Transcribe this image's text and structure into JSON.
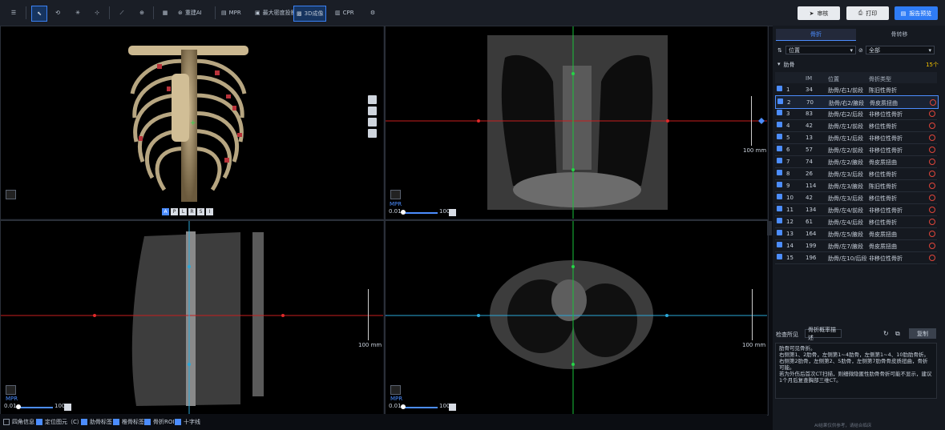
{
  "toolbar": {
    "tool_labels": {
      "ai": "重建AI",
      "mpr": "MPR",
      "mip": "最大密度投影",
      "vr": "3D成像",
      "cpr": "CPR"
    },
    "report_btns": {
      "submit": "审核",
      "print": "打印",
      "view": "报告预览"
    }
  },
  "viewports": {
    "orient": [
      "A",
      "P",
      "L",
      "R",
      "S",
      "I"
    ],
    "scale_text": "100 mm",
    "slider_min": "0.01",
    "slider_max": "100",
    "mpr_label": "MPR"
  },
  "right_panel": {
    "tabs": [
      "骨折",
      "骨转移"
    ],
    "filter_pos": "位置",
    "filter_type": "全部",
    "section": "肋骨",
    "count": "15个",
    "headers": [
      "IM",
      "位置",
      "骨折类型"
    ],
    "rows": [
      {
        "n": "1",
        "im": "34",
        "pos": "肋骨/右1/前段",
        "type": "陈旧性骨折"
      },
      {
        "n": "2",
        "im": "70",
        "pos": "肋骨/右2/腋段",
        "type": "骨皮质扭曲"
      },
      {
        "n": "3",
        "im": "83",
        "pos": "肋骨/右2/后段",
        "type": "非移位性骨折"
      },
      {
        "n": "4",
        "im": "42",
        "pos": "肋骨/左1/前段",
        "type": "移位性骨折"
      },
      {
        "n": "5",
        "im": "13",
        "pos": "肋骨/左1/后段",
        "type": "非移位性骨折"
      },
      {
        "n": "6",
        "im": "57",
        "pos": "肋骨/左2/前段",
        "type": "非移位性骨折"
      },
      {
        "n": "7",
        "im": "74",
        "pos": "肋骨/左2/腋段",
        "type": "骨皮质扭曲"
      },
      {
        "n": "8",
        "im": "26",
        "pos": "肋骨/左3/后段",
        "type": "移位性骨折"
      },
      {
        "n": "9",
        "im": "114",
        "pos": "肋骨/左3/腋段",
        "type": "陈旧性骨折"
      },
      {
        "n": "10",
        "im": "42",
        "pos": "肋骨/左3/后段",
        "type": "移位性骨折"
      },
      {
        "n": "11",
        "im": "134",
        "pos": "肋骨/左4/前段",
        "type": "非移位性骨折"
      },
      {
        "n": "12",
        "im": "61",
        "pos": "肋骨/左4/后段",
        "type": "移位性骨折"
      },
      {
        "n": "13",
        "im": "164",
        "pos": "肋骨/左5/腋段",
        "type": "骨皮质扭曲"
      },
      {
        "n": "14",
        "im": "199",
        "pos": "肋骨/左7/腋段",
        "type": "骨皮质扭曲"
      },
      {
        "n": "15",
        "im": "196",
        "pos": "肋骨/左10/后段",
        "type": "非移位性骨折"
      }
    ],
    "findings_label": "检查所见",
    "findings_select": "骨折概率描述",
    "copy_btn": "复制",
    "findings_text": "肋骨可见骨折。\n右侧第1、2肋骨，左侧第1~4肋骨，左侧第1~4、10肋肋骨折。\n右侧第2肋骨，左侧第2、5肋骨，左侧第7肋骨骨皮质扭曲，骨折可能。\n若为外伤后首次CT扫描，则细微隐匿性肋骨骨折可能不显示，建议1个月后复查胸部三维CT。",
    "footer": "AI结果仅供参考，请结合临床"
  },
  "bottom": [
    "四角信息",
    "定位图元（C）",
    "肋骨标签",
    "椎骨标签",
    "骨折ROI",
    "十字线"
  ]
}
